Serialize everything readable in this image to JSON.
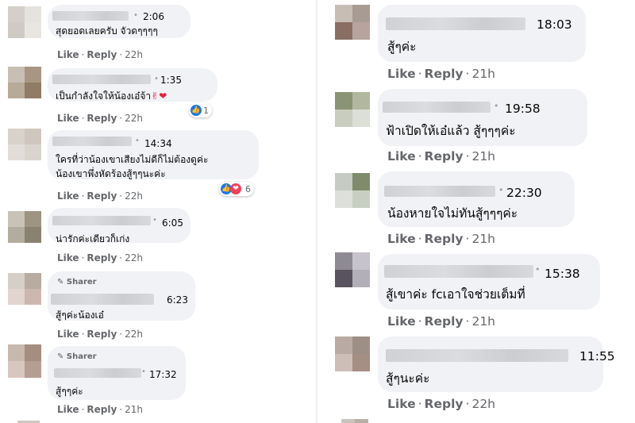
{
  "left_comments": [
    {
      "time": "2:06",
      "text": "สุดยอดเลยครับ จัวดๆๆๆๆ",
      "like": "Like",
      "reply": "Reply",
      "age": "22h"
    },
    {
      "time": "1:35",
      "text": "เป็นกำลังใจให้น้องเอ๋จ้า",
      "emoji": "✌❤",
      "reaction_count": "1",
      "like": "Like",
      "reply": "Reply",
      "age": "22h"
    },
    {
      "time": "14:34",
      "text_line1": "ใครที่ว่าน้องเขาเสียงไม่ดีก็ไม่ต้องดูค่ะ",
      "text_line2": "น้องเขาพึ่งหัดร้องสู้ๆๆนะค่ะ",
      "reaction_count": "6",
      "like": "Like",
      "reply": "Reply",
      "age": "22h"
    },
    {
      "time": "6:05",
      "text": "น่ารักค่ะเดียวก็เก่ง",
      "like": "Like",
      "reply": "Reply",
      "age": "22h"
    },
    {
      "badge": "Sharer",
      "time": "6:23",
      "text": "สู้ๆค่ะน้องเอ๋",
      "like": "Like",
      "reply": "Reply",
      "age": "22h"
    },
    {
      "badge": "Sharer",
      "time": "17:32",
      "text": "สู้ๆๆค่ะ",
      "like": "Like",
      "reply": "Reply",
      "age": "21h"
    }
  ],
  "right_comments": [
    {
      "time": "18:03",
      "text": "สู้ๆค่ะ",
      "like": "Like",
      "reply": "Reply",
      "age": "21h"
    },
    {
      "time": "19:58",
      "text": "ฟ้าเปิดให้เอ๋แล้ว สู้ๆๆๆค่ะ",
      "like": "Like",
      "reply": "Reply",
      "age": "21h"
    },
    {
      "time": "22:30",
      "text": "น้องหายใจไม่ทันสู้ๆๆๆค่ะ",
      "like": "Like",
      "reply": "Reply",
      "age": "21h"
    },
    {
      "time": "15:38",
      "text": "สู้เขาค่ะ fcเอาใจช่วยเต็มที่",
      "like": "Like",
      "reply": "Reply",
      "age": "21h"
    },
    {
      "time": "11:55",
      "text": "สู้ๆนะค่ะ",
      "like": "Like",
      "reply": "Reply",
      "age": "22h"
    }
  ],
  "colors": {
    "like_blue": "#1877f2",
    "heart_red": "#f33e58",
    "bubble": "#f0f2f5",
    "meta": "#65676b"
  }
}
